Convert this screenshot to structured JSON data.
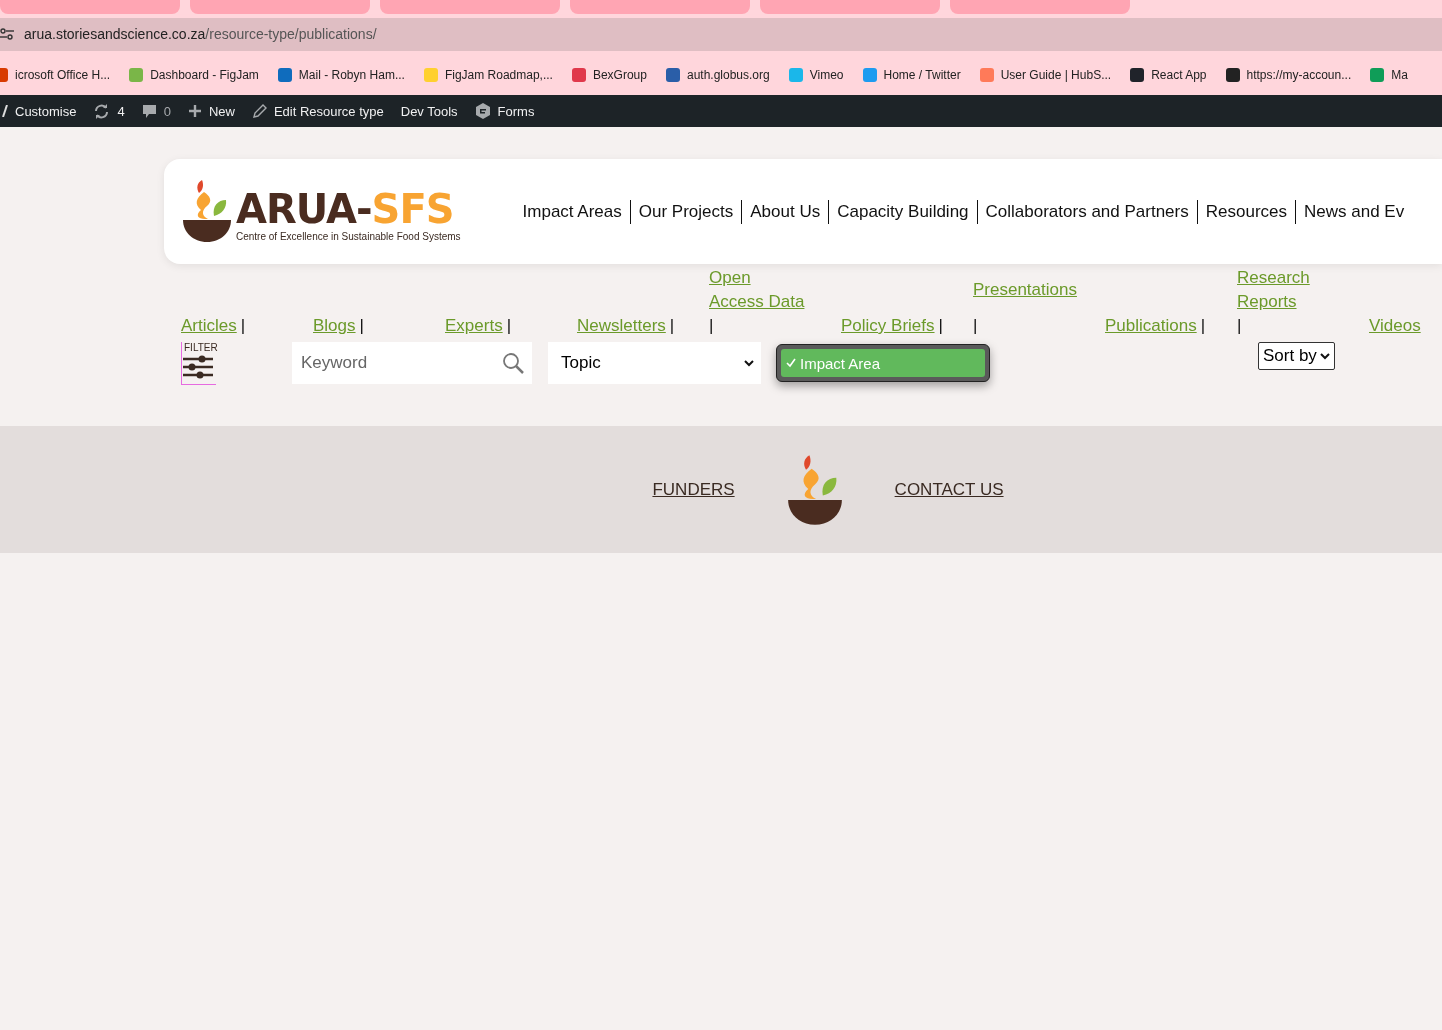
{
  "browser": {
    "address": {
      "host": "arua.storiesandscience.co.za",
      "path": "/resource-type/publications/"
    },
    "bookmarks": [
      {
        "label": "icrosoft Office H...",
        "color": "#d83b01"
      },
      {
        "label": "Dashboard - FigJam",
        "color": "#7ab648"
      },
      {
        "label": "Mail - Robyn Ham...",
        "color": "#0f6cbd"
      },
      {
        "label": "FigJam Roadmap,...",
        "color": "#ffd02f"
      },
      {
        "label": "BexGroup",
        "color": "#e0384b"
      },
      {
        "label": "auth.globus.org",
        "color": "#2a5ea8"
      },
      {
        "label": "Vimeo",
        "color": "#1ab7ea"
      },
      {
        "label": "Home / Twitter",
        "color": "#1d9bf0"
      },
      {
        "label": "User Guide | HubS...",
        "color": "#ff7a59"
      },
      {
        "label": "React App",
        "color": "#20232a"
      },
      {
        "label": "https://my-accoun...",
        "color": "#222222"
      },
      {
        "label": "Ma",
        "color": "#0f9d58"
      }
    ]
  },
  "admin_bar": [
    {
      "kind": "customise",
      "label": "Customise"
    },
    {
      "kind": "updates",
      "label": "4"
    },
    {
      "kind": "comments",
      "label": "0"
    },
    {
      "kind": "new",
      "label": "New"
    },
    {
      "kind": "edit",
      "label": "Edit Resource type"
    },
    {
      "kind": "text",
      "label": "Dev Tools"
    },
    {
      "kind": "forms",
      "label": "Forms"
    }
  ],
  "header": {
    "logo": {
      "name_dark": "ARUA-",
      "name_accent": "SFS",
      "tagline": "Centre of Excellence in Sustainable Food Systems"
    },
    "nav": [
      "Impact Areas",
      "Our Projects",
      "About Us",
      "Capacity Building",
      "Collaborators and Partners",
      "Resources",
      "News and Ev"
    ]
  },
  "resource_types": [
    {
      "label": "Articles",
      "separator": "|"
    },
    {
      "label": "Blogs",
      "separator": "|"
    },
    {
      "label": "Experts",
      "separator": "|"
    },
    {
      "label": "Newsletters",
      "separator": "|"
    },
    {
      "label": "Open Access Data",
      "separator": "|"
    },
    {
      "label": "Policy Briefs",
      "separator": "|"
    },
    {
      "label": "Presentations",
      "separator": "|"
    },
    {
      "label": "Publications",
      "separator": "|"
    },
    {
      "label": "Research Reports",
      "separator": "|"
    },
    {
      "label": "Videos"
    }
  ],
  "filters": {
    "filter_label": "FILTER",
    "keyword": {
      "placeholder": "Keyword"
    },
    "topic": "Topic",
    "impact_area": {
      "options": [
        {
          "label": "Impact Area",
          "selected": true
        }
      ]
    },
    "sort": "Sort by"
  },
  "footer": {
    "links": [
      "FUNDERS",
      "CONTACT US"
    ]
  }
}
